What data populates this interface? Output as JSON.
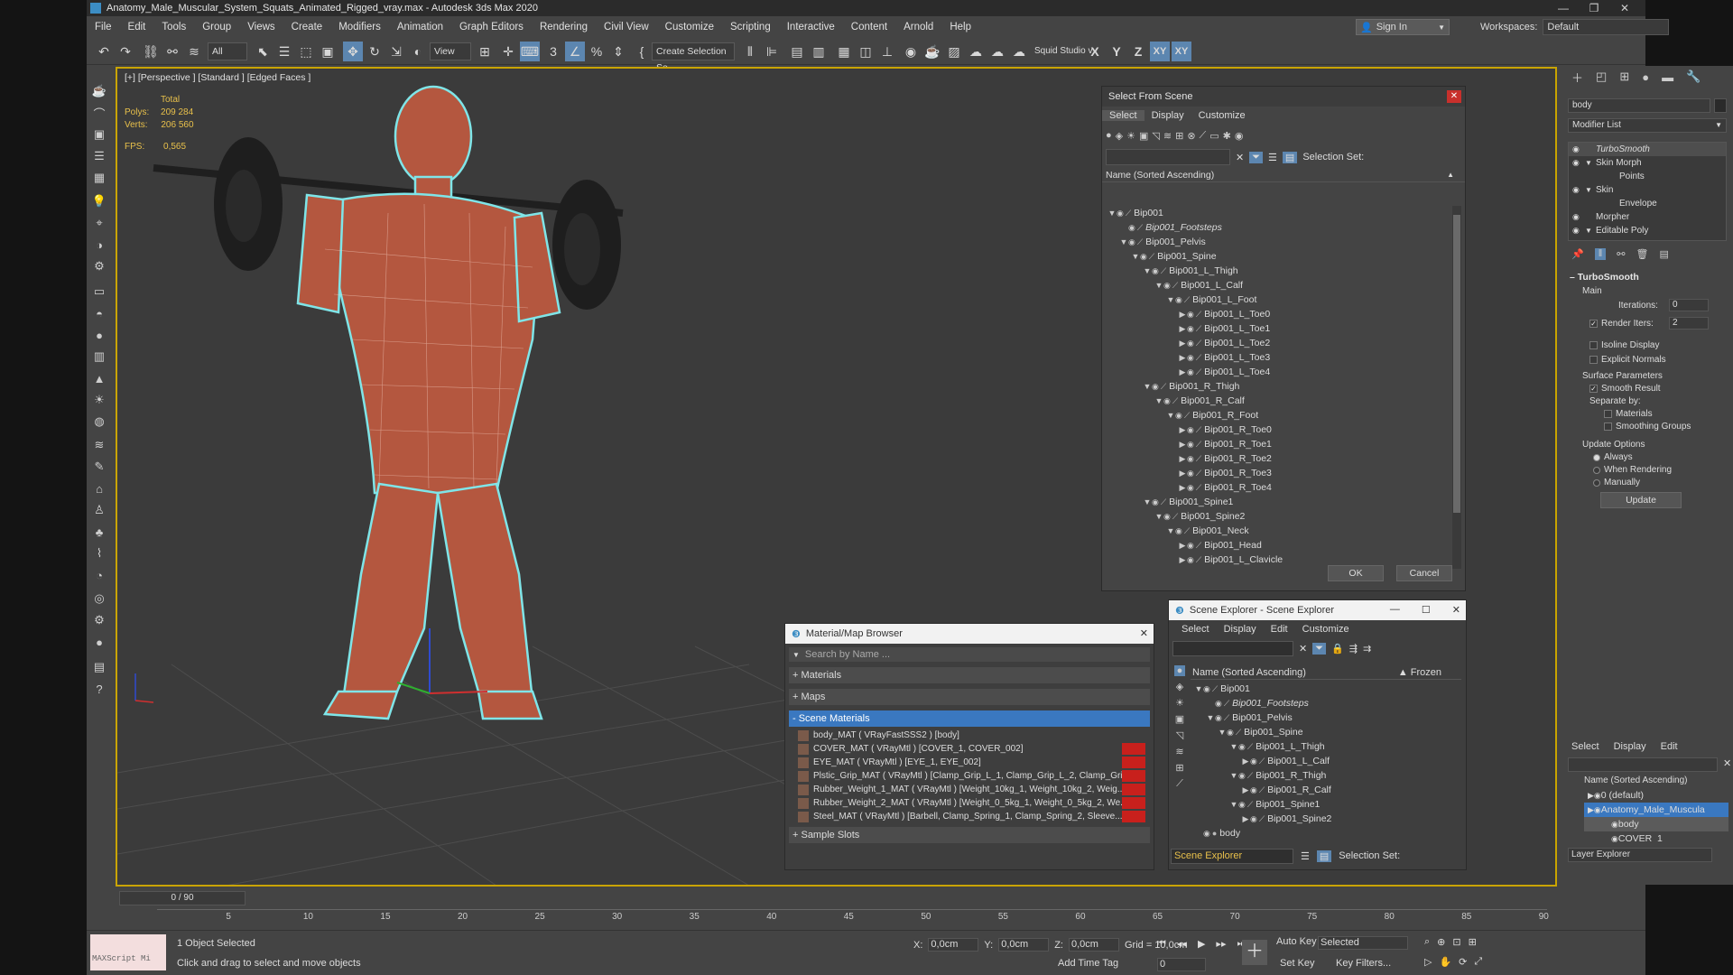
{
  "title_bar": {
    "title": "Anatomy_Male_Muscular_System_Squats_Animated_Rigged_vray.max - Autodesk 3ds Max 2020"
  },
  "menu": [
    "File",
    "Edit",
    "Tools",
    "Group",
    "Views",
    "Create",
    "Modifiers",
    "Animation",
    "Graph Editors",
    "Rendering",
    "Civil View",
    "Customize",
    "Scripting",
    "Interactive",
    "Content",
    "Arnold",
    "Help"
  ],
  "header_right": {
    "signin": "Sign In",
    "workspace_label": "Workspaces:",
    "workspace_value": "Default"
  },
  "toolbar": {
    "filter": "All",
    "ref_coord": "View",
    "named_sel": "Create Selection Se",
    "studio": "Squid Studio v",
    "axes": [
      "X",
      "Y",
      "Z",
      "XY",
      "XY"
    ]
  },
  "viewport": {
    "label": "[+] [Perspective ] [Standard ] [Edged Faces ]",
    "stats": {
      "total_label": "Total",
      "polys_label": "Polys:",
      "polys_value": "209 284",
      "verts_label": "Verts:",
      "verts_value": "206 560",
      "fps_label": "FPS:",
      "fps_value": "0,565"
    }
  },
  "select_from_scene": {
    "title": "Select From Scene",
    "menus": [
      "Select",
      "Display",
      "Customize"
    ],
    "selection_set_label": "Selection Set:",
    "column": "Name (Sorted Ascending)",
    "rows": [
      {
        "label": "Bip001",
        "depth": 0,
        "arrow": "down"
      },
      {
        "label": "Bip001_Footsteps",
        "depth": 1,
        "arrow": "",
        "italic": true
      },
      {
        "label": "Bip001_Pelvis",
        "depth": 1,
        "arrow": "down"
      },
      {
        "label": "Bip001_Spine",
        "depth": 2,
        "arrow": "down"
      },
      {
        "label": "Bip001_L_Thigh",
        "depth": 3,
        "arrow": "down"
      },
      {
        "label": "Bip001_L_Calf",
        "depth": 4,
        "arrow": "down"
      },
      {
        "label": "Bip001_L_Foot",
        "depth": 5,
        "arrow": "down"
      },
      {
        "label": "Bip001_L_Toe0",
        "depth": 6,
        "arrow": "right"
      },
      {
        "label": "Bip001_L_Toe1",
        "depth": 6,
        "arrow": "right"
      },
      {
        "label": "Bip001_L_Toe2",
        "depth": 6,
        "arrow": "right"
      },
      {
        "label": "Bip001_L_Toe3",
        "depth": 6,
        "arrow": "right"
      },
      {
        "label": "Bip001_L_Toe4",
        "depth": 6,
        "arrow": "right"
      },
      {
        "label": "Bip001_R_Thigh",
        "depth": 3,
        "arrow": "down"
      },
      {
        "label": "Bip001_R_Calf",
        "depth": 4,
        "arrow": "down"
      },
      {
        "label": "Bip001_R_Foot",
        "depth": 5,
        "arrow": "down"
      },
      {
        "label": "Bip001_R_Toe0",
        "depth": 6,
        "arrow": "right"
      },
      {
        "label": "Bip001_R_Toe1",
        "depth": 6,
        "arrow": "right"
      },
      {
        "label": "Bip001_R_Toe2",
        "depth": 6,
        "arrow": "right"
      },
      {
        "label": "Bip001_R_Toe3",
        "depth": 6,
        "arrow": "right"
      },
      {
        "label": "Bip001_R_Toe4",
        "depth": 6,
        "arrow": "right"
      },
      {
        "label": "Bip001_Spine1",
        "depth": 3,
        "arrow": "down"
      },
      {
        "label": "Bip001_Spine2",
        "depth": 4,
        "arrow": "down"
      },
      {
        "label": "Bip001_Neck",
        "depth": 5,
        "arrow": "down"
      },
      {
        "label": "Bip001_Head",
        "depth": 6,
        "arrow": "right"
      },
      {
        "label": "Bip001_L_Clavicle",
        "depth": 6,
        "arrow": "right"
      }
    ],
    "ok": "OK",
    "cancel": "Cancel"
  },
  "material_browser": {
    "title": "Material/Map Browser",
    "search_placeholder": "Search by Name ...",
    "sections": [
      "+ Materials",
      "+ Maps"
    ],
    "scene_materials_label": "- Scene Materials",
    "items": [
      "body_MAT ( VRayFastSSS2 ) [body]",
      "COVER_MAT ( VRayMtl ) [COVER_1, COVER_002]",
      "EYE_MAT ( VRayMtl ) [EYE_1, EYE_002]",
      "Plstic_Grip_MAT ( VRayMtl ) [Clamp_Grip_L_1, Clamp_Grip_L_2, Clamp_Grip...",
      "Rubber_Weight_1_MAT ( VRayMtl ) [Weight_10kg_1, Weight_10kg_2, Weig...",
      "Rubber_Weight_2_MAT ( VRayMtl ) [Weight_0_5kg_1, Weight_0_5kg_2, We...",
      "Steel_MAT ( VRayMtl ) [Barbell, Clamp_Spring_1, Clamp_Spring_2, Sleeve..."
    ],
    "sample_slots": "+ Sample Slots"
  },
  "scene_explorer": {
    "title": "Scene Explorer - Scene Explorer",
    "menus": [
      "Select",
      "Display",
      "Edit",
      "Customize"
    ],
    "column": "Name (Sorted Ascending)",
    "frozen_col": "▲ Frozen",
    "rows": [
      {
        "label": "Bip001",
        "depth": 0,
        "arrow": "down"
      },
      {
        "label": "Bip001_Footsteps",
        "depth": 1,
        "arrow": "",
        "italic": true
      },
      {
        "label": "Bip001_Pelvis",
        "depth": 1,
        "arrow": "down"
      },
      {
        "label": "Bip001_Spine",
        "depth": 2,
        "arrow": "down"
      },
      {
        "label": "Bip001_L_Thigh",
        "depth": 3,
        "arrow": "down"
      },
      {
        "label": "Bip001_L_Calf",
        "depth": 4,
        "arrow": "right"
      },
      {
        "label": "Bip001_R_Thigh",
        "depth": 3,
        "arrow": "down"
      },
      {
        "label": "Bip001_R_Calf",
        "depth": 4,
        "arrow": "right"
      },
      {
        "label": "Bip001_Spine1",
        "depth": 3,
        "arrow": "down"
      },
      {
        "label": "Bip001_Spine2",
        "depth": 4,
        "arrow": "right"
      },
      {
        "label": "body",
        "depth": 0,
        "arrow": ""
      }
    ],
    "footer_dropdown": "Scene Explorer",
    "selection_set_label": "Selection Set:"
  },
  "command_panel": {
    "search_value": "body",
    "modifier_list": "Modifier List",
    "stack": [
      {
        "label": "TurboSmooth",
        "italic": true,
        "arrow": "",
        "indent": 0
      },
      {
        "label": "Skin Morph",
        "italic": false,
        "arrow": "▼",
        "indent": 0
      },
      {
        "label": "Points",
        "italic": false,
        "arrow": "",
        "indent": 1
      },
      {
        "label": "Skin",
        "italic": false,
        "arrow": "▼",
        "indent": 0
      },
      {
        "label": "Envelope",
        "italic": false,
        "arrow": "",
        "indent": 1
      },
      {
        "label": "Morpher",
        "italic": false,
        "arrow": "",
        "indent": 0
      },
      {
        "label": "Editable Poly",
        "italic": false,
        "arrow": "▼",
        "indent": 0
      }
    ],
    "turbosmooth": {
      "title": "TurboSmooth",
      "main": "Main",
      "iterations_label": "Iterations:",
      "iterations_value": "0",
      "render_iters_label": "Render Iters:",
      "render_iters_value": "2",
      "isoline": "Isoline Display",
      "explicit": "Explicit Normals",
      "surface_params": "Surface Parameters",
      "smooth_result": "Smooth Result",
      "separate_by": "Separate by:",
      "materials": "Materials",
      "smoothing_groups": "Smoothing Groups",
      "update_options": "Update Options",
      "always": "Always",
      "when_rendering": "When Rendering",
      "manually": "Manually",
      "update_btn": "Update"
    }
  },
  "layer_explorer": {
    "menus": [
      "Select",
      "Display",
      "Edit"
    ],
    "column": "Name (Sorted Ascending)",
    "rows": [
      "0 (default)",
      "Anatomy_Male_Muscula",
      "body",
      "COVER_1"
    ],
    "footer": "Layer Explorer"
  },
  "timeline": {
    "frame": "0 / 90",
    "ticks": [
      "5",
      "10",
      "15",
      "20",
      "25",
      "30",
      "35",
      "40",
      "45",
      "50",
      "55",
      "60",
      "65",
      "70",
      "75",
      "80",
      "85",
      "90"
    ]
  },
  "status": {
    "maxscript": "MAXScript Mi",
    "selected": "1 Object Selected",
    "hint": "Click and drag to select and move objects",
    "x_label": "X:",
    "x_value": "0,0cm",
    "y_label": "Y:",
    "y_value": "0,0cm",
    "z_label": "Z:",
    "z_value": "0,0cm",
    "grid": "Grid = 10,0cm",
    "add_time_tag": "Add Time Tag",
    "auto_key": "Auto Key",
    "set_key": "Set Key",
    "selected_dd": "Selected",
    "key_filters": "Key Filters...",
    "frame_value": "0"
  }
}
